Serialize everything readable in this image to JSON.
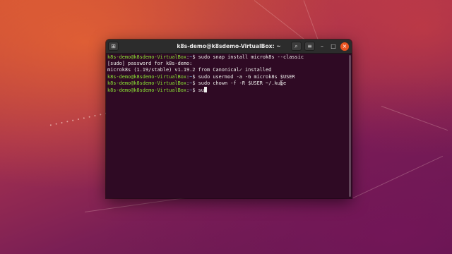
{
  "window": {
    "title": "k8s-demo@k8sdemo-VirtualBox: ~",
    "icons": {
      "new_tab": "new-tab-icon",
      "search": "search-icon",
      "menu": "hamburger-menu-icon",
      "minimize": "minimize-icon",
      "maximize": "maximize-icon",
      "close": "close-icon"
    },
    "glyphs": {
      "new_tab": "⊞",
      "search": "⌕",
      "menu": "≡",
      "minimize": "–",
      "maximize": "□",
      "close": "×"
    }
  },
  "terminal": {
    "prompt_user": "k8s-demo@k8sdemo-VirtualBox",
    "prompt_sep": ":",
    "prompt_path": "~",
    "prompt_symbol": "$ ",
    "lines": [
      {
        "type": "cmd",
        "text": "sudo snap install microk8s --classic"
      },
      {
        "type": "out",
        "text": "[sudo] password for k8s-demo:"
      },
      {
        "type": "out",
        "text": "microk8s (1.19/stable) v1.19.2 from Canonical✓ installed"
      },
      {
        "type": "cmd",
        "text": "sudo usermod -a -G microk8s $USER"
      },
      {
        "type": "cmd",
        "text": "sudo chown -f -R $USER ~/.kube"
      },
      {
        "type": "cmd",
        "text": "su"
      }
    ]
  },
  "colors": {
    "prompt_user": "#8ae234",
    "prompt_path": "#729fcf",
    "terminal_bg": "#2f0a24",
    "close_button": "#e95420"
  }
}
